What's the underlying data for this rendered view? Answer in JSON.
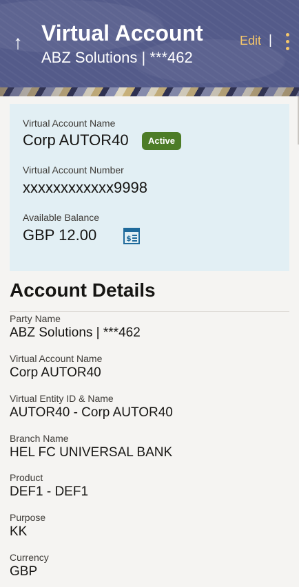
{
  "header": {
    "title": "Virtual Account",
    "subtitle": "ABZ Solutions | ***462",
    "edit_label": "Edit",
    "separator": "|"
  },
  "summary": {
    "account_name_label": "Virtual Account Name",
    "account_name": "Corp AUTOR40",
    "status_badge": "Active",
    "account_number_label": "Virtual Account Number",
    "account_number": "xxxxxxxxxxxx9998",
    "balance_label": "Available Balance",
    "balance": "GBP 12.00"
  },
  "details": {
    "title": "Account Details",
    "fields": [
      {
        "label": "Party Name",
        "value": "ABZ Solutions | ***462"
      },
      {
        "label": "Virtual Account Name",
        "value": "Corp AUTOR40"
      },
      {
        "label": "Virtual Entity ID & Name",
        "value": "AUTOR40 - Corp AUTOR40"
      },
      {
        "label": "Branch Name",
        "value": "HEL FC UNIVERSAL BANK"
      },
      {
        "label": "Product",
        "value": "DEF1 - DEF1"
      },
      {
        "label": "Purpose",
        "value": "KK"
      },
      {
        "label": "Currency",
        "value": "GBP"
      }
    ]
  },
  "icons": {
    "back": "arrow-up-icon",
    "more": "kebab-icon",
    "statement": "statement-icon"
  },
  "colors": {
    "header_bg": "#545b8a",
    "accent": "#f5c76b",
    "card_bg": "#e2eff4",
    "badge_bg": "#4d7c27",
    "icon_blue": "#1f6a9b"
  }
}
